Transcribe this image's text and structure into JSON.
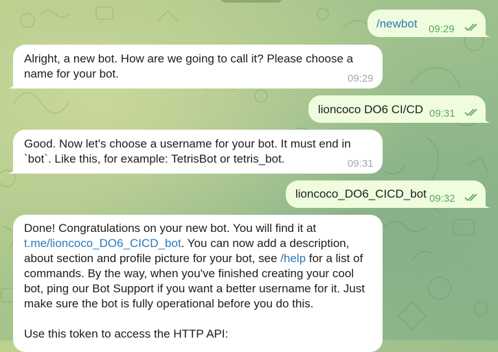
{
  "chat": {
    "messages": [
      {
        "direction": "out",
        "text": "/newbot",
        "time": "09:29"
      },
      {
        "direction": "in",
        "text": "Alright, a new bot. How are we going to call it? Please choose a name for your bot.",
        "time": "09:29"
      },
      {
        "direction": "out",
        "text": "lioncoco DO6 CI/CD",
        "time": "09:31"
      },
      {
        "direction": "in",
        "text": "Good. Now let's choose a username for your bot. It must end in `bot`. Like this, for example: TetrisBot or tetris_bot.",
        "time": "09:31"
      },
      {
        "direction": "out",
        "text": "lioncoco_DO6_CICD_bot",
        "time": "09:32"
      },
      {
        "direction": "in",
        "part1": "Done! Congratulations on your new bot. You will find it at ",
        "link": "t.me/lioncoco_DO6_CICD_bot",
        "part2": ". You can now add a description, about section and profile picture for your bot, see ",
        "command": "/help",
        "part3": " for a list of commands. By the way, when you've finished creating your cool bot, ping our Bot Support if you want a better username for it. Just make sure the bot is fully operational before you do this.",
        "part4": "Use this token to access the HTTP API:"
      }
    ]
  },
  "colors": {
    "incoming_bubble": "#ffffff",
    "outgoing_bubble": "#effdde",
    "link": "#2a7ab8",
    "outgoing_meta": "#5fa561",
    "incoming_meta": "#a0a8ae"
  },
  "icons": {
    "read_receipt": "double-check-icon"
  }
}
